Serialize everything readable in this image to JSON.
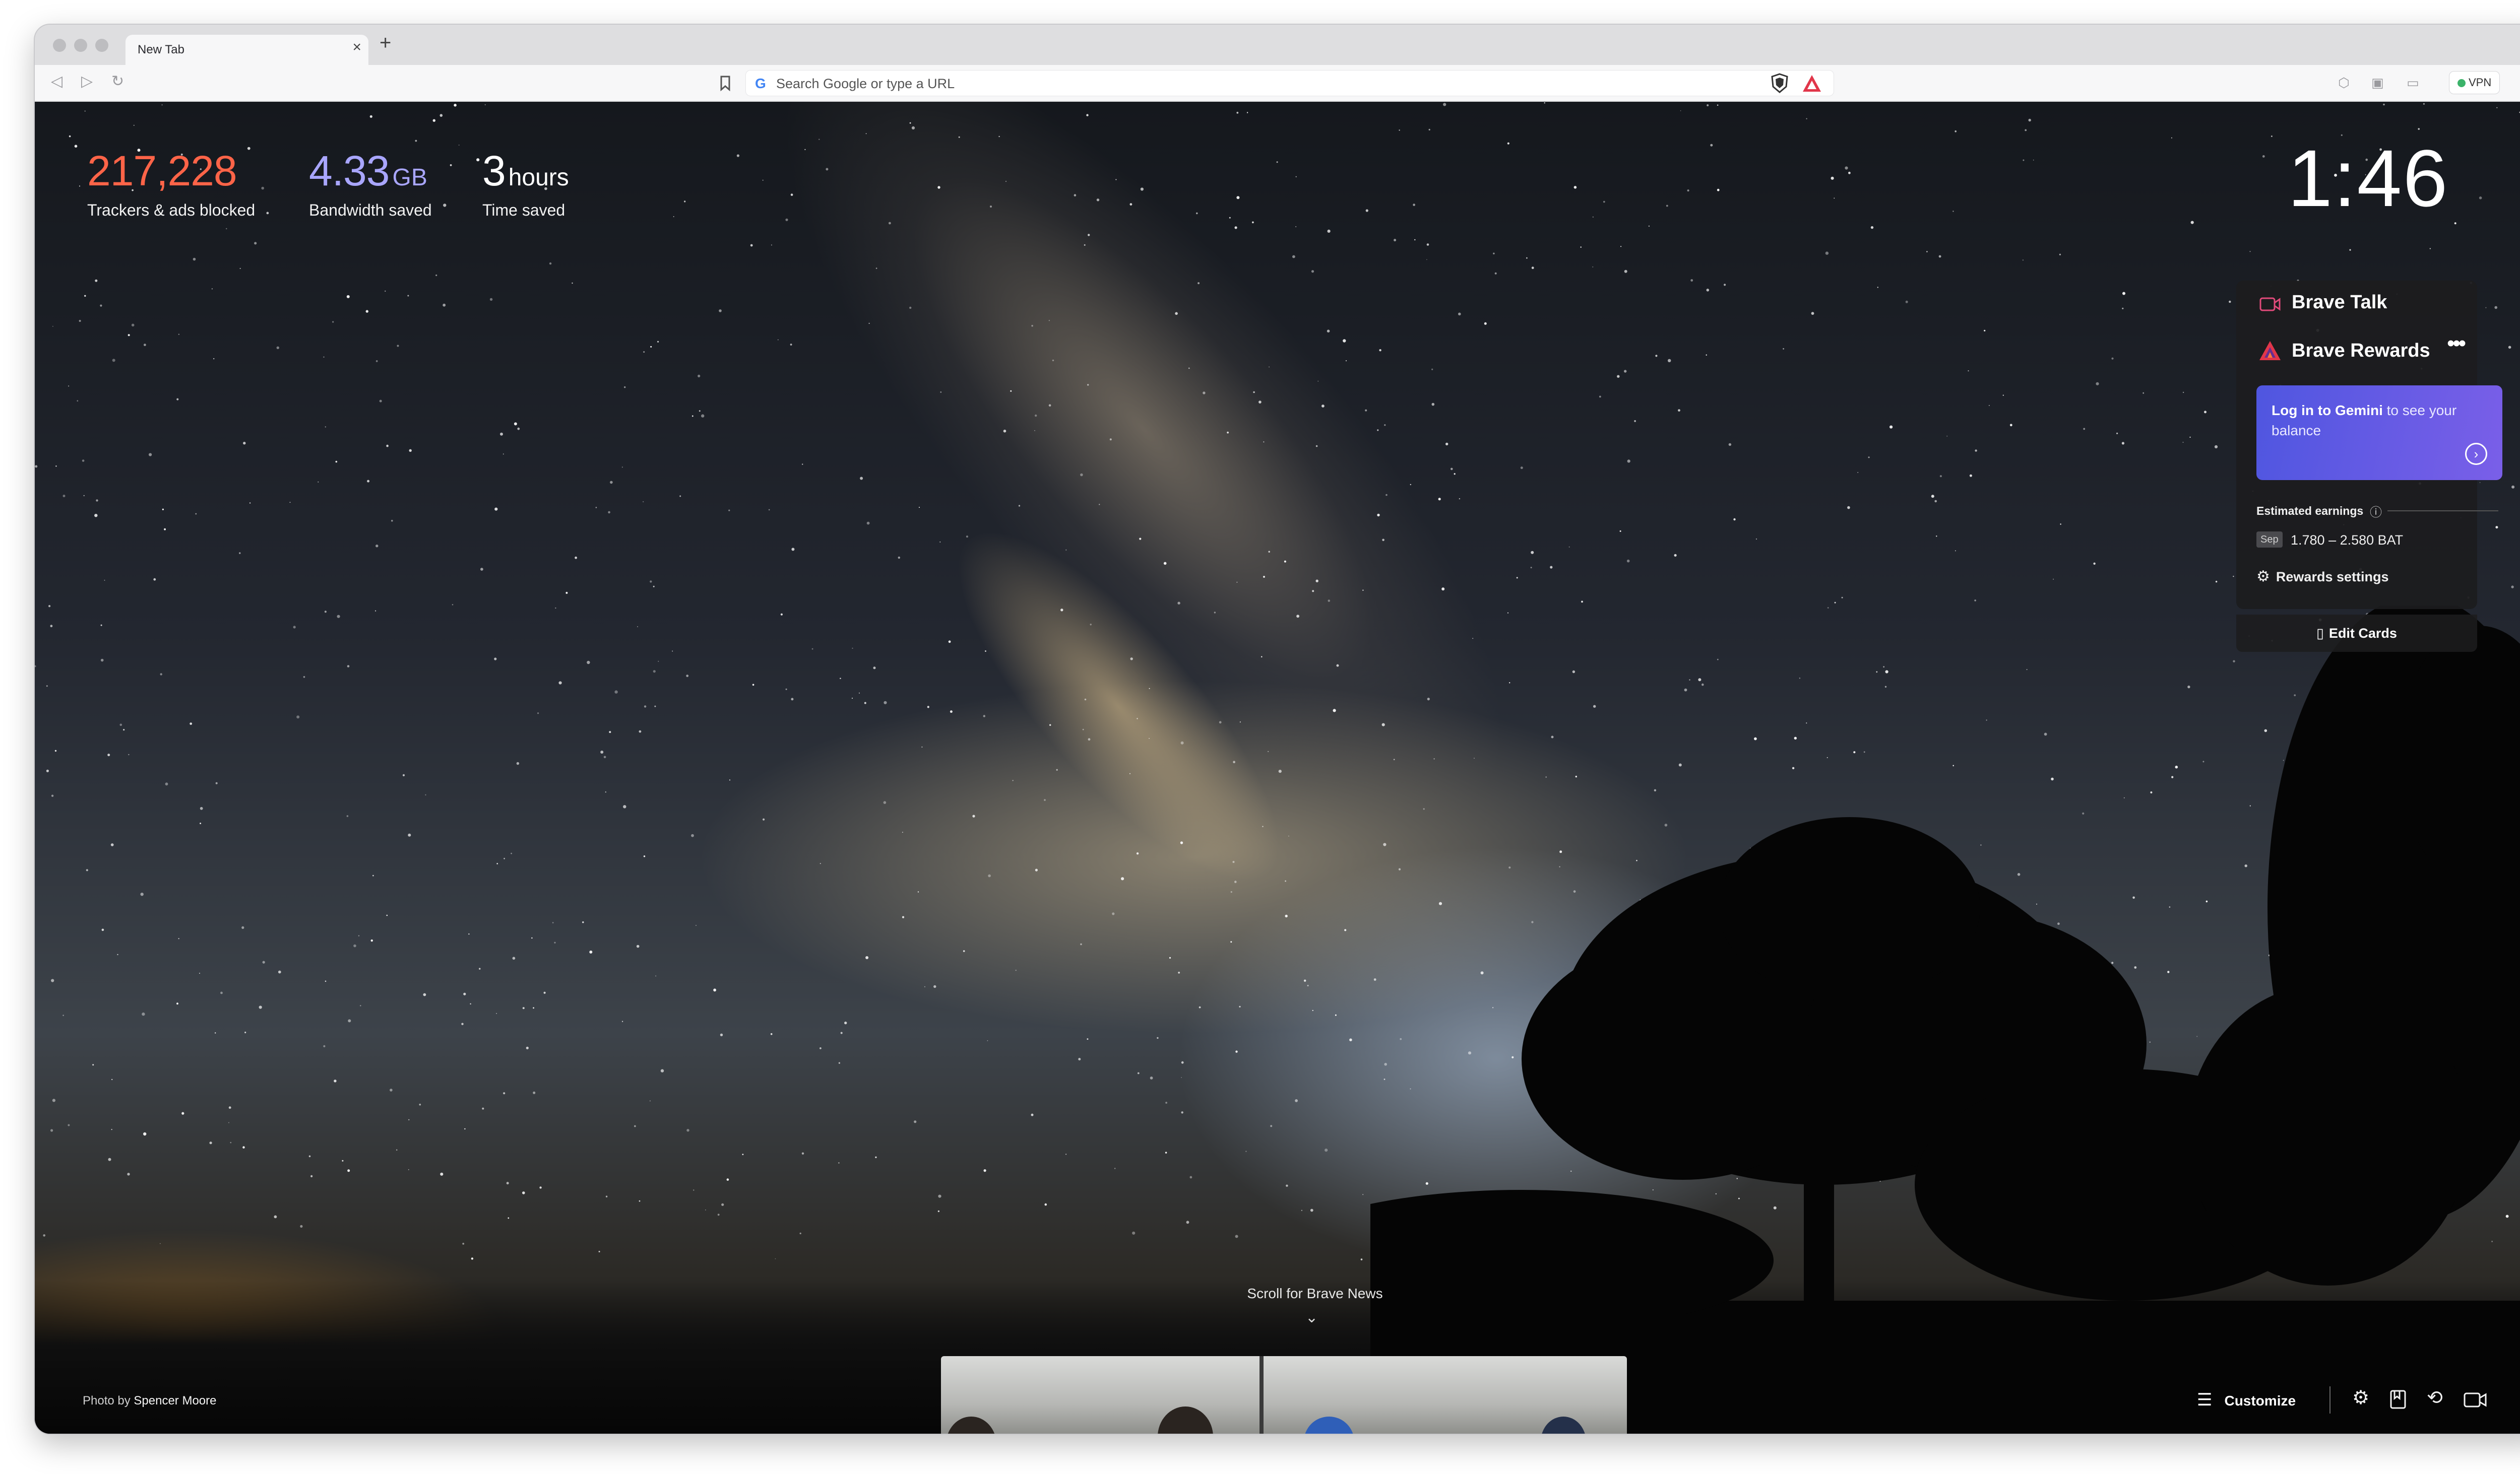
{
  "browser": {
    "tab_title": "New Tab",
    "tab_close": "×",
    "new_tab": "+",
    "tab_menu": "⌄",
    "omnibox_placeholder": "Search Google or type a URL",
    "google_glyph": "G",
    "vpn_label": "VPN",
    "menu_glyph": "≡"
  },
  "stats": {
    "trackers": {
      "value": "217,228",
      "label": "Trackers & ads blocked"
    },
    "bandwidth": {
      "value": "4.33",
      "unit": "GB",
      "label": "Bandwidth saved"
    },
    "time": {
      "value": "3",
      "unit": "hours",
      "label": "Time saved"
    }
  },
  "clock": "1:46",
  "cards": {
    "talk": {
      "title": "Brave Talk"
    },
    "rewards": {
      "title": "Brave Rewards",
      "more": "•••",
      "gemini_link": "Log in to Gemini",
      "gemini_rest": " to see your balance",
      "gemini_arrow": "›",
      "earnings_label": "Estimated earnings",
      "earnings_info": "ⓘ",
      "earnings_month": "Sep",
      "earnings_range": "1.780 – 2.580 BAT",
      "settings_icon": "⚙",
      "settings_label": "Rewards settings"
    },
    "edit_icon": "▯",
    "edit_label": "Edit Cards"
  },
  "news": {
    "hint": "Scroll for Brave News",
    "chevron": "⌄"
  },
  "footer": {
    "photo_prefix": "Photo by",
    "photo_author": "Spencer Moore",
    "customize_icon": "☰",
    "customize_label": "Customize",
    "icons": [
      "settings-icon",
      "bookmarks-icon",
      "history-icon",
      "video-call-icon"
    ]
  },
  "colors": {
    "trackers_value": "#ff6448",
    "bandwidth_value": "#a9a6ff",
    "gemini_gradient_start": "#4f56e0",
    "gemini_gradient_end": "#7a5fe8",
    "vpn_status": "#3bb36a"
  }
}
